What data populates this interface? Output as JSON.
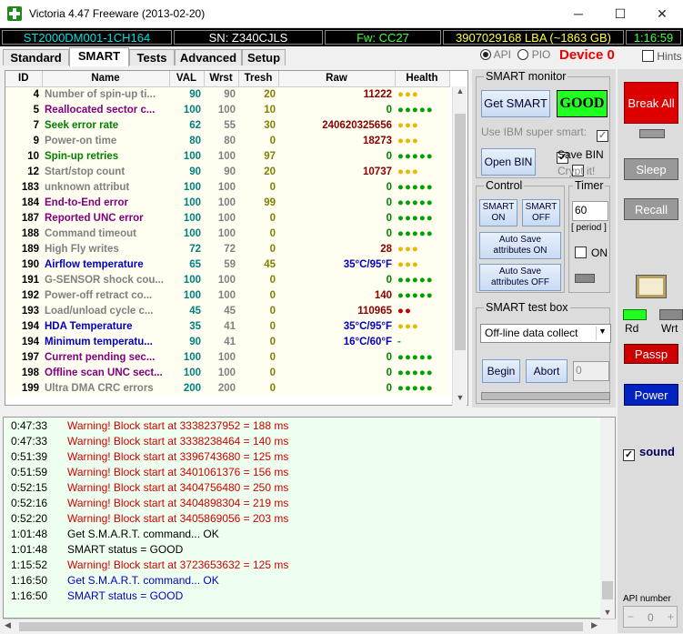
{
  "window": {
    "title": "Victoria 4.47  Freeware (2013-02-20)",
    "minimize": "─",
    "maximize": "☐",
    "close": "✕"
  },
  "infobar": {
    "model": "ST2000DM001-1CH164",
    "serial": "SN: Z340CJLS",
    "firmware": "Fw: CC27",
    "lba": "3907029168 LBA (~1863 GB)",
    "time": "1:16:59"
  },
  "tabs": [
    "Standard",
    "SMART",
    "Tests",
    "Advanced",
    "Setup"
  ],
  "mode": {
    "api": "API",
    "pio": "PIO"
  },
  "device": "Device 0",
  "hints": "Hints",
  "smart_table": {
    "headers": [
      "ID",
      "Name",
      "VAL",
      "Wrst",
      "Tresh",
      "Raw",
      "Health"
    ],
    "rows": [
      {
        "id": "4",
        "name": "Number of spin-up ti...",
        "val": "90",
        "wrst": "90",
        "tresh": "20",
        "raw": "11222",
        "health": "●●●",
        "color": "#808080",
        "hcolor": "#e8b800"
      },
      {
        "id": "5",
        "name": "Reallocated sector c...",
        "val": "100",
        "wrst": "100",
        "tresh": "10",
        "raw": "0",
        "health": "●●●●●",
        "color": "#800080",
        "hcolor": "#00a000"
      },
      {
        "id": "7",
        "name": "Seek error rate",
        "val": "62",
        "wrst": "55",
        "tresh": "30",
        "raw": "240620325656",
        "health": "●●●",
        "color": "#008000",
        "hcolor": "#e8b800"
      },
      {
        "id": "9",
        "name": "Power-on time",
        "val": "80",
        "wrst": "80",
        "tresh": "0",
        "raw": "18273",
        "health": "●●●",
        "color": "#808080",
        "hcolor": "#e8b800"
      },
      {
        "id": "10",
        "name": "Spin-up retries",
        "val": "100",
        "wrst": "100",
        "tresh": "97",
        "raw": "0",
        "health": "●●●●●",
        "color": "#008000",
        "hcolor": "#00a000"
      },
      {
        "id": "12",
        "name": "Start/stop count",
        "val": "90",
        "wrst": "90",
        "tresh": "20",
        "raw": "10737",
        "health": "●●●",
        "color": "#808080",
        "hcolor": "#e8b800"
      },
      {
        "id": "183",
        "name": "unknown attribut",
        "val": "100",
        "wrst": "100",
        "tresh": "0",
        "raw": "0",
        "health": "●●●●●",
        "color": "#808080",
        "hcolor": "#00a000"
      },
      {
        "id": "184",
        "name": "End-to-End error",
        "val": "100",
        "wrst": "100",
        "tresh": "99",
        "raw": "0",
        "health": "●●●●●",
        "color": "#800080",
        "hcolor": "#00a000"
      },
      {
        "id": "187",
        "name": "Reported UNC error",
        "val": "100",
        "wrst": "100",
        "tresh": "0",
        "raw": "0",
        "health": "●●●●●",
        "color": "#800080",
        "hcolor": "#00a000"
      },
      {
        "id": "188",
        "name": "Command timeout",
        "val": "100",
        "wrst": "100",
        "tresh": "0",
        "raw": "0",
        "health": "●●●●●",
        "color": "#808080",
        "hcolor": "#00a000"
      },
      {
        "id": "189",
        "name": "High Fly writes",
        "val": "72",
        "wrst": "72",
        "tresh": "0",
        "raw": "28",
        "health": "●●●",
        "color": "#808080",
        "hcolor": "#e8b800"
      },
      {
        "id": "190",
        "name": "Airflow temperature",
        "val": "65",
        "wrst": "59",
        "tresh": "45",
        "raw": "35°C/95°F",
        "health": "●●●",
        "color": "#0000c0",
        "hcolor": "#e8b800"
      },
      {
        "id": "191",
        "name": "G-SENSOR shock cou...",
        "val": "100",
        "wrst": "100",
        "tresh": "0",
        "raw": "0",
        "health": "●●●●●",
        "color": "#808080",
        "hcolor": "#00a000"
      },
      {
        "id": "192",
        "name": "Power-off retract co...",
        "val": "100",
        "wrst": "100",
        "tresh": "0",
        "raw": "140",
        "health": "●●●●●",
        "color": "#808080",
        "hcolor": "#00a000"
      },
      {
        "id": "193",
        "name": "Load/unload cycle c...",
        "val": "45",
        "wrst": "45",
        "tresh": "0",
        "raw": "110965",
        "health": "●●",
        "color": "#808080",
        "hcolor": "#c00000"
      },
      {
        "id": "194",
        "name": "HDA Temperature",
        "val": "35",
        "wrst": "41",
        "tresh": "0",
        "raw": "35°C/95°F",
        "health": "●●●",
        "color": "#0000c0",
        "hcolor": "#e8b800"
      },
      {
        "id": "194",
        "name": "Minimum temperatu...",
        "val": "90",
        "wrst": "41",
        "tresh": "0",
        "raw": "16°C/60°F",
        "health": "-",
        "color": "#0000c0",
        "hcolor": "#00a000"
      },
      {
        "id": "197",
        "name": "Current pending sec...",
        "val": "100",
        "wrst": "100",
        "tresh": "0",
        "raw": "0",
        "health": "●●●●●",
        "color": "#800080",
        "hcolor": "#00a000"
      },
      {
        "id": "198",
        "name": "Offline scan UNC sect...",
        "val": "100",
        "wrst": "100",
        "tresh": "0",
        "raw": "0",
        "health": "●●●●●",
        "color": "#800080",
        "hcolor": "#00a000"
      },
      {
        "id": "199",
        "name": "Ultra DMA CRC errors",
        "val": "200",
        "wrst": "200",
        "tresh": "0",
        "raw": "0",
        "health": "●●●●●",
        "color": "#808080",
        "hcolor": "#00a000"
      }
    ]
  },
  "smart_monitor": {
    "label": "SMART monitor",
    "get_smart": "Get SMART",
    "status": "GOOD",
    "ibm_label": "Use IBM super smart:",
    "open_bin": "Open BIN",
    "save_bin": "Save BIN",
    "crypt_it": "Crypt it!"
  },
  "control": {
    "label": "Control",
    "smart_on": "SMART ON",
    "smart_off": "SMART OFF",
    "auto_on": "Auto Save attributes ON",
    "auto_off": "Auto Save attributes OFF"
  },
  "timer": {
    "label": "Timer",
    "value": "60",
    "period": "[ period ]",
    "on": "ON"
  },
  "test_box": {
    "label": "SMART test box",
    "selected": "Off-line data collect",
    "begin": "Begin",
    "abort": "Abort",
    "count": "0"
  },
  "side": {
    "break_all": "Break All",
    "sleep": "Sleep",
    "recall": "Recall",
    "rd": "Rd",
    "wrt": "Wrt",
    "passp": "Passp",
    "power": "Power",
    "sound": "sound",
    "api_number_label": "API number",
    "api_number": "0"
  },
  "log": [
    {
      "time": "0:47:33",
      "msg": "Warning! Block start at 3338237952 = 188 ms",
      "color": "#d00000"
    },
    {
      "time": "0:47:33",
      "msg": "Warning! Block start at 3338238464 = 140 ms",
      "color": "#d00000"
    },
    {
      "time": "0:51:39",
      "msg": "Warning! Block start at 3396743680 = 125 ms",
      "color": "#d00000"
    },
    {
      "time": "0:51:59",
      "msg": "Warning! Block start at 3401061376 = 156 ms",
      "color": "#d00000"
    },
    {
      "time": "0:52:15",
      "msg": "Warning! Block start at 3404756480 = 250 ms",
      "color": "#d00000"
    },
    {
      "time": "0:52:16",
      "msg": "Warning! Block start at 3404898304 = 219 ms",
      "color": "#d00000"
    },
    {
      "time": "0:52:20",
      "msg": "Warning! Block start at 3405869056 = 203 ms",
      "color": "#d00000"
    },
    {
      "time": "1:01:48",
      "msg": "Get S.M.A.R.T. command... OK",
      "color": "#000000"
    },
    {
      "time": "1:01:48",
      "msg": "SMART status = GOOD",
      "color": "#000000"
    },
    {
      "time": "1:15:52",
      "msg": "Warning! Block start at 3723653632 = 125 ms",
      "color": "#d00000"
    },
    {
      "time": "1:16:50",
      "msg": "Get S.M.A.R.T. command... OK",
      "color": "#0000c0"
    },
    {
      "time": "1:16:50",
      "msg": "SMART status = GOOD",
      "color": "#0000c0"
    }
  ]
}
